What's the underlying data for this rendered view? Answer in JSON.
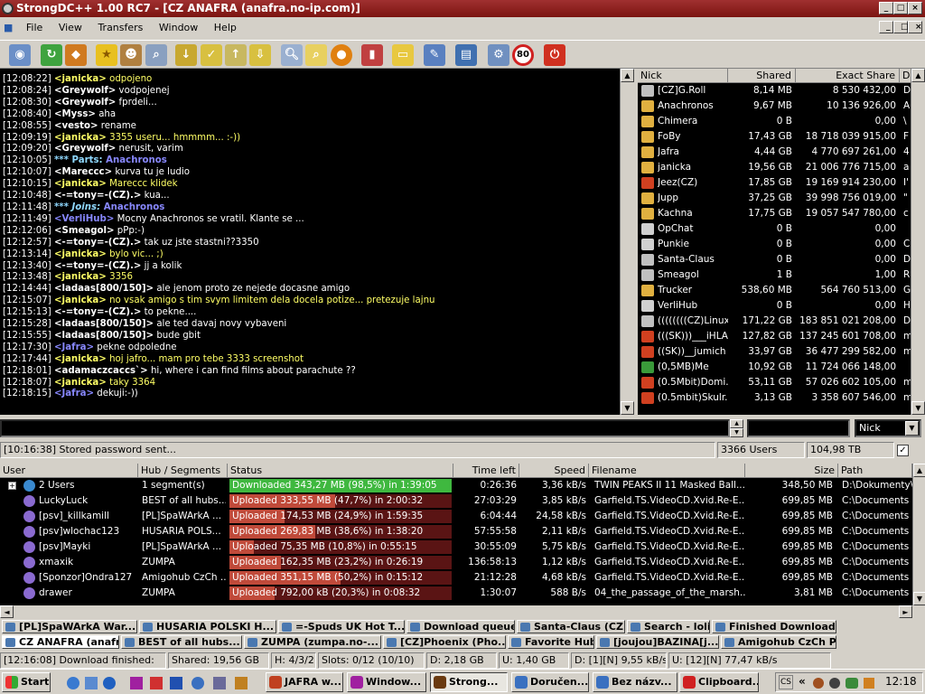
{
  "window": {
    "title": "StrongDC++ 1.00 RC7 - [CZ ANAFRA (anafra.no-ip.com)]",
    "colors": {
      "titlebar": "#8b1a14",
      "accent_green": "#3fb83f",
      "progress_red": "#c04a3a"
    }
  },
  "menu": [
    "File",
    "View",
    "Transfers",
    "Window",
    "Help"
  ],
  "toolbar_icons": [
    "hub-icon",
    "refresh-icon",
    "reconnect-icon",
    "favorite-icon",
    "users-icon",
    "search-spy-icon",
    "queue-icon",
    "finished-icon",
    "upload-icon",
    "download-icon",
    "search-icon",
    "adl-icon",
    "network-icon",
    "stats-icon",
    "folder-icon",
    "notepad-icon",
    "book-icon",
    "settings-icon",
    "limit-icon",
    "quit-icon"
  ],
  "toolbar_limit": "80",
  "chat": [
    {
      "t": "[12:08:22]",
      "n": "<janicka>",
      "m": " odpojeno",
      "c": "#ffff66"
    },
    {
      "t": "[12:08:24]",
      "n": "<Greywolf>",
      "m": " vodpojenej",
      "c": "#ffffff"
    },
    {
      "t": "[12:08:30]",
      "n": "<Greywolf>",
      "m": " fprdeli...",
      "c": "#ffffff"
    },
    {
      "t": "[12:08:40]",
      "n": "<Myss>",
      "m": " aha",
      "c": "#ffffff"
    },
    {
      "t": "[12:08:55]",
      "n": "<vesto>",
      "m": " rename",
      "c": "#ffffff"
    },
    {
      "t": "[12:09:19]",
      "n": "<janicka>",
      "m": " 3355 useru... hmmmm... :-))",
      "c": "#ffff66"
    },
    {
      "t": "[12:09:20]",
      "n": "<Greywolf>",
      "m": " nerusit, varim",
      "c": "#ffffff"
    },
    {
      "t": "[12:10:05]",
      "n": "*** Parts:",
      "m": " Anachronos",
      "c": "#ffffff",
      "sys": true
    },
    {
      "t": "[12:10:07]",
      "n": "<Mareccc>",
      "m": " kurva tu je ludio",
      "c": "#ffffff"
    },
    {
      "t": "[12:10:15]",
      "n": "<janicka>",
      "m": " Mareccc klidek",
      "c": "#ffff66"
    },
    {
      "t": "[12:10:48]",
      "n": "<-=tony=-(CZ).>",
      "m": " kua...",
      "c": "#ffffff"
    },
    {
      "t": "[12:11:48]",
      "n": "*** Joins:",
      "m": " Anachronos",
      "c": "#ffffff",
      "sys": true
    },
    {
      "t": "[12:11:49]",
      "n": "<VerliHub>",
      "m": " Mocny Anachronos se vratil. Klante se ...",
      "c": "#8888ff"
    },
    {
      "t": "[12:12:06]",
      "n": "<Smeagol>",
      "m": " pPp:-)",
      "c": "#ffffff"
    },
    {
      "t": "[12:12:57]",
      "n": "<-=tony=-(CZ).>",
      "m": " tak uz jste stastni??3350",
      "c": "#ffffff"
    },
    {
      "t": "[12:13:14]",
      "n": "<janicka>",
      "m": " bylo vic... ;)",
      "c": "#ffff66"
    },
    {
      "t": "[12:13:40]",
      "n": "<-=tony=-(CZ).>",
      "m": " jj a kolik",
      "c": "#ffffff"
    },
    {
      "t": "[12:13:48]",
      "n": "<janicka>",
      "m": " 3356",
      "c": "#ffff66"
    },
    {
      "t": "[12:14:44]",
      "n": "<ladaas[800/150]>",
      "m": " ale jenom proto ze nejede docasne amigo",
      "c": "#ffffff"
    },
    {
      "t": "[12:15:07]",
      "n": "<janicka>",
      "m": " no vsak amigo s tim svym limitem dela docela potize... pretezuje lajnu",
      "c": "#ffff66"
    },
    {
      "t": "[12:15:13]",
      "n": "<-=tony=-(CZ).>",
      "m": " to pekne....",
      "c": "#ffffff"
    },
    {
      "t": "[12:15:28]",
      "n": "<ladaas[800/150]>",
      "m": " ale ted davaj novy vybaveni",
      "c": "#ffffff"
    },
    {
      "t": "[12:15:55]",
      "n": "<ladaas[800/150]>",
      "m": " bude gbit",
      "c": "#ffffff"
    },
    {
      "t": "[12:17:30]",
      "n": "<Jafra>",
      "m": " pekne odpoledne",
      "c": "#8888ff"
    },
    {
      "t": "[12:17:44]",
      "n": "<janicka>",
      "m": " hoj jafro... mam pro tebe 3333 screenshot",
      "c": "#ffff66"
    },
    {
      "t": "[12:18:01]",
      "n": "<adamaczcaccs`>",
      "m": " hi, where i can find films about parachute ??",
      "c": "#ffffff"
    },
    {
      "t": "[12:18:07]",
      "n": "<janicka>",
      "m": " taky 3364",
      "c": "#ffff66"
    },
    {
      "t": "[12:18:15]",
      "n": "<Jafra>",
      "m": " dekuji:-))",
      "c": "#8888ff"
    }
  ],
  "userlist": {
    "columns": [
      "Nick",
      "Shared",
      "Exact Share",
      "D"
    ],
    "rows": [
      {
        "nick": "[CZ]G.Roll",
        "shared": "8,14 MB",
        "exact": "8 530 432,00",
        "d": "D"
      },
      {
        "nick": "Anachronos",
        "shared": "9,67 MB",
        "exact": "10 136 926,00",
        "d": "A"
      },
      {
        "nick": "Chimera",
        "shared": "0 B",
        "exact": "0,00",
        "d": "\\"
      },
      {
        "nick": "FoBy",
        "shared": "17,43 GB",
        "exact": "18 718 039 915,00",
        "d": "F"
      },
      {
        "nick": "Jafra",
        "shared": "4,44 GB",
        "exact": "4 770 697 261,00",
        "d": "4"
      },
      {
        "nick": "janicka",
        "shared": "19,56 GB",
        "exact": "21 006 776 715,00",
        "d": "a"
      },
      {
        "nick": "Jeez(CZ)",
        "shared": "17,85 GB",
        "exact": "19 169 914 230,00",
        "d": "I'"
      },
      {
        "nick": "Jupp",
        "shared": "37,25 GB",
        "exact": "39 998 756 019,00",
        "d": "\""
      },
      {
        "nick": "Kachna",
        "shared": "17,75 GB",
        "exact": "19 057 547 780,00",
        "d": "c"
      },
      {
        "nick": "OpChat",
        "shared": "0 B",
        "exact": "0,00",
        "d": ""
      },
      {
        "nick": "Punkie",
        "shared": "0 B",
        "exact": "0,00",
        "d": "C"
      },
      {
        "nick": "Santa-Claus",
        "shared": "0 B",
        "exact": "0,00",
        "d": "D"
      },
      {
        "nick": "Smeagol",
        "shared": "1 B",
        "exact": "1,00",
        "d": "R"
      },
      {
        "nick": "Trucker",
        "shared": "538,60 MB",
        "exact": "564 760 513,00",
        "d": "G"
      },
      {
        "nick": "VerliHub",
        "shared": "0 B",
        "exact": "0,00",
        "d": "H"
      },
      {
        "nick": "((((((((CZ)Linux",
        "shared": "171,22 GB",
        "exact": "183 851 021 208,00",
        "d": "D"
      },
      {
        "nick": "(((SK)))___iHLA",
        "shared": "127,82 GB",
        "exact": "137 245 601 708,00",
        "d": "m"
      },
      {
        "nick": "((SK))__jumich",
        "shared": "33,97 GB",
        "exact": "36 477 299 582,00",
        "d": "m"
      },
      {
        "nick": "(0,5MB)Me",
        "shared": "10,92 GB",
        "exact": "11 724 066 148,00",
        "d": ""
      },
      {
        "nick": "(0.5Mbit)Domi...",
        "shared": "53,11 GB",
        "exact": "57 026 602 105,00",
        "d": "m"
      },
      {
        "nick": "(0.5mbit)Skulr...",
        "shared": "3,13 GB",
        "exact": "3 358 607 546,00",
        "d": "m"
      }
    ]
  },
  "input": {
    "nick_select": "Nick"
  },
  "status": {
    "message": "[10:16:38] Stored password sent...",
    "users": "3366 Users",
    "shared": "104,98 TB"
  },
  "transfers": {
    "columns": [
      "User",
      "Hub / Segments",
      "Status",
      "Time left",
      "Speed",
      "Filename",
      "Size",
      "Path"
    ],
    "rows": [
      {
        "user": "2 Users",
        "hub": "1 segment(s)",
        "status": "Downloaded 343,27 MB (98,5%) in 1:39:05",
        "pct": 0.985,
        "down": true,
        "left": "0:26:36",
        "speed": "3,36 kB/s",
        "file": "TWIN PEAKS II 11 Masked Ball...",
        "size": "348,50 MB",
        "path": "D:\\Dokumenty\\"
      },
      {
        "user": "LuckyLuck",
        "hub": "BEST of all hubs...",
        "status": "Uploaded 333,55 MB (47,7%) in 2:00:32",
        "pct": 0.477,
        "left": "27:03:29",
        "speed": "3,85 kB/s",
        "file": "Garfield.TS.VideoCD.Xvid.Re-E...",
        "size": "699,85 MB",
        "path": "C:\\Documents a"
      },
      {
        "user": "[psv]_killkamill",
        "hub": "[PL]SpaWArkA ...",
        "status": "Uploaded 174,53 MB (24,9%) in 1:59:35",
        "pct": 0.249,
        "left": "6:04:44",
        "speed": "24,58 kB/s",
        "file": "Garfield.TS.VideoCD.Xvid.Re-E...",
        "size": "699,85 MB",
        "path": "C:\\Documents a"
      },
      {
        "user": "[psv]wlochac123",
        "hub": "HUSARIA POLS...",
        "status": "Uploaded 269,83 MB (38,6%) in 1:38:20",
        "pct": 0.386,
        "left": "57:55:58",
        "speed": "2,11 kB/s",
        "file": "Garfield.TS.VideoCD.Xvid.Re-E...",
        "size": "699,85 MB",
        "path": "C:\\Documents a"
      },
      {
        "user": "[psv]Mayki",
        "hub": "[PL]SpaWArkA ...",
        "status": "Uploaded 75,35 MB (10,8%) in 0:55:15",
        "pct": 0.108,
        "left": "30:55:09",
        "speed": "5,75 kB/s",
        "file": "Garfield.TS.VideoCD.Xvid.Re-E...",
        "size": "699,85 MB",
        "path": "C:\\Documents a"
      },
      {
        "user": "xmaxik",
        "hub": "ZUMPA",
        "status": "Uploaded 162,35 MB (23,2%) in 0:26:19",
        "pct": 0.232,
        "left": "136:58:13",
        "speed": "1,12 kB/s",
        "file": "Garfield.TS.VideoCD.Xvid.Re-E...",
        "size": "699,85 MB",
        "path": "C:\\Documents a"
      },
      {
        "user": "[Sponzor]Ondra127",
        "hub": "Amigohub CzCh ...",
        "status": "Uploaded 351,15 MB (50,2%) in 0:15:12",
        "pct": 0.502,
        "left": "21:12:28",
        "speed": "4,68 kB/s",
        "file": "Garfield.TS.VideoCD.Xvid.Re-E...",
        "size": "699,85 MB",
        "path": "C:\\Documents a"
      },
      {
        "user": "drawer",
        "hub": "ZUMPA",
        "status": "Uploaded 792,00 kB (20,3%) in 0:08:32",
        "pct": 0.203,
        "left": "1:30:07",
        "speed": "588 B/s",
        "file": "04_the_passage_of_the_marsh...",
        "size": "3,81 MB",
        "path": "C:\\Documents a"
      }
    ]
  },
  "tabs_row1": [
    "[PL]SpaWArkA War...",
    "HUSARIA POLSKI H...",
    "=-Spuds UK Hot T...",
    "Download queue",
    "Santa-Claus (CZ ...",
    "Search - lolita",
    "Finished Downloads"
  ],
  "tabs_row2": [
    "CZ ANAFRA (anafr...",
    "BEST of all hubs...",
    "ZUMPA (zumpa.no-...",
    "[CZ]Phoenix (Pho...",
    "Favorite Hubs",
    "[joujou]BAZINA[j...",
    "Amigohub CzCh Pr..."
  ],
  "statusbar": [
    "[12:16:08] Download finished:",
    "Shared: 19,56 GB",
    "H: 4/3/2",
    "Slots: 0/12 (10/10)",
    "D: 2,18 GB",
    "U: 1,40 GB",
    "D: [1][N] 9,55 kB/s",
    "U: [12][N] 77,47 kB/s"
  ],
  "taskbar": {
    "start": "Start",
    "items": [
      "JAFRA w...",
      "Window...",
      "Strong...",
      "Doručen...",
      "Bez názv...",
      "Clipboard..."
    ],
    "lang": "CS",
    "clock": "12:18"
  }
}
